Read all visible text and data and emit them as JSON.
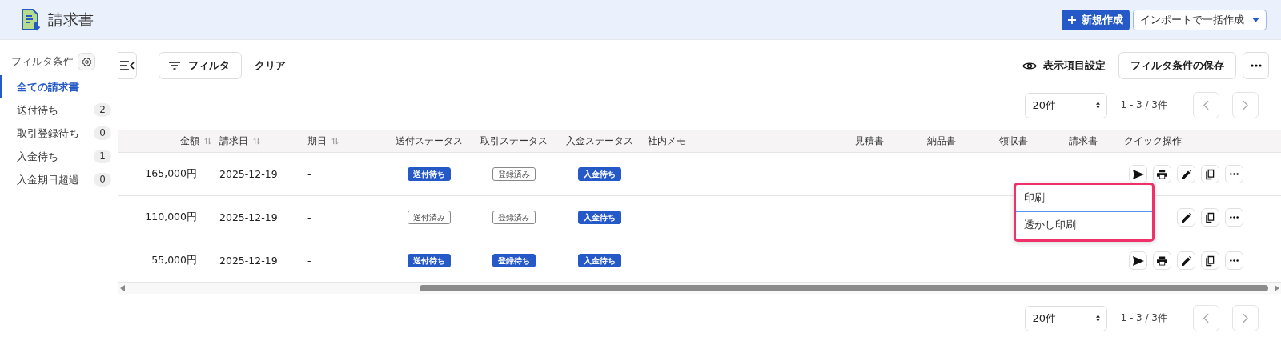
{
  "header": {
    "title": "請求書",
    "new_button": "新規作成",
    "import_button": "インポートで一括作成"
  },
  "sidebar": {
    "heading": "フィルタ条件",
    "items": [
      {
        "label": "全ての請求書",
        "selected": true
      },
      {
        "label": "送付待ち",
        "count": "2",
        "selected": false
      },
      {
        "label": "取引登録待ち",
        "count": "0",
        "selected": false
      },
      {
        "label": "入金待ち",
        "count": "1",
        "selected": false
      },
      {
        "label": "入金期日超過",
        "count": "0",
        "selected": false
      }
    ]
  },
  "toolbar": {
    "filter_button": "フィルタ",
    "clear_link": "クリア",
    "columns_setting": "表示項目設定",
    "save_filter_button": "フィルタ条件の保存"
  },
  "pagination_top": {
    "page_size": "20件",
    "range": "1 - 3 / 3件",
    "prev_disabled": true,
    "next_disabled": true
  },
  "table": {
    "columns": [
      {
        "label": "金額",
        "sortable": true
      },
      {
        "label": "請求日",
        "sortable": true
      },
      {
        "label": "期日",
        "sortable": true
      },
      {
        "label": "送付ステータス",
        "sortable": false
      },
      {
        "label": "取引ステータス",
        "sortable": false
      },
      {
        "label": "入金ステータス",
        "sortable": false
      },
      {
        "label": "社内メモ",
        "sortable": false
      },
      {
        "label": "見積書",
        "sortable": false
      },
      {
        "label": "納品書",
        "sortable": false
      },
      {
        "label": "領収書",
        "sortable": false
      },
      {
        "label": "請求書",
        "sortable": false
      },
      {
        "label": "クイック操作",
        "sortable": false
      }
    ],
    "rows": [
      {
        "amount": "165,000円",
        "date": "2025-12-19",
        "due": "-",
        "send": {
          "label": "送付待ち",
          "kind": "filled"
        },
        "deal": {
          "label": "登録済み",
          "kind": "outline"
        },
        "pay": {
          "label": "入金待ち",
          "kind": "filled"
        }
      },
      {
        "amount": "110,000円",
        "date": "2025-12-19",
        "due": "-",
        "send": {
          "label": "送付済み",
          "kind": "outline"
        },
        "deal": {
          "label": "登録済み",
          "kind": "outline"
        },
        "pay": {
          "label": "入金待ち",
          "kind": "filled"
        }
      },
      {
        "amount": "55,000円",
        "date": "2025-12-19",
        "due": "-",
        "send": {
          "label": "送付待ち",
          "kind": "filled"
        },
        "deal": {
          "label": "登録待ち",
          "kind": "filled"
        },
        "pay": {
          "label": "入金待ち",
          "kind": "filled"
        }
      }
    ]
  },
  "print_menu": {
    "items": [
      {
        "label": "印刷",
        "selected": true
      },
      {
        "label": "透かし印刷",
        "selected": false
      }
    ]
  },
  "pagination_bottom": {
    "page_size": "20件",
    "range": "1 - 3 / 3件",
    "prev_disabled": true,
    "next_disabled": true
  }
}
